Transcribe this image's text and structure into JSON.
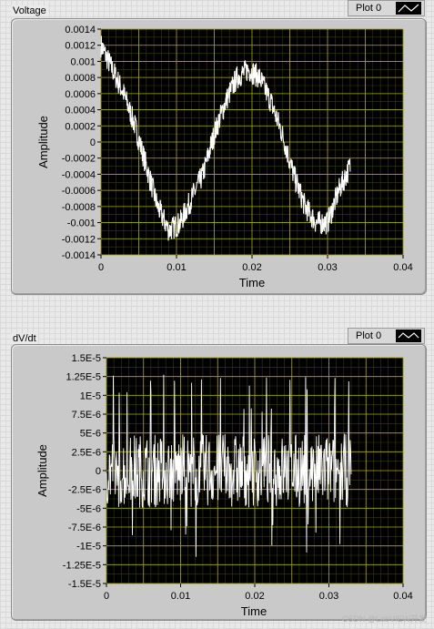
{
  "graph1": {
    "label": "Voltage",
    "legend": "Plot 0",
    "xlabel": "Time",
    "ylabel": "Amplitude",
    "yticks": [
      "0.0014",
      "0.0012",
      "0.001",
      "0.0008",
      "0.0006",
      "0.0004",
      "0.0002",
      "0",
      "-0.0002",
      "-0.0004",
      "-0.0006",
      "-0.0008",
      "-0.001",
      "-0.0012",
      "-0.0014"
    ],
    "xticks": [
      "0",
      "0.01",
      "0.02",
      "0.03",
      "0.04"
    ]
  },
  "graph2": {
    "label": "dV/dt",
    "legend": "Plot 0",
    "xlabel": "Time",
    "ylabel": "Amplitude",
    "yticks": [
      "1.5E-5",
      "1.25E-5",
      "1E-5",
      "7.5E-6",
      "5E-6",
      "2.5E-6",
      "0",
      "-2.5E-6",
      "-5E-6",
      "-7.5E-6",
      "-1E-5",
      "-1.25E-5",
      "-1.5E-5"
    ],
    "xticks": [
      "0",
      "0.01",
      "0.02",
      "0.03",
      "0.04"
    ]
  },
  "watermark": "CSDN @LabVIEW开发",
  "colors": {
    "plot_bg": "#000000",
    "grid_major": "#a8a800",
    "grid_minor": "#3c3c00",
    "trace": "#ffffff"
  },
  "chart_data": [
    {
      "type": "line",
      "title": "Voltage",
      "xlabel": "Time",
      "ylabel": "Amplitude",
      "xlim": [
        0,
        0.04
      ],
      "ylim": [
        -0.0014,
        0.0014
      ],
      "grid": true,
      "legend": "top-right",
      "series": [
        {
          "name": "Plot 0",
          "x": [
            0,
            0.0015,
            0.003,
            0.0045,
            0.006,
            0.0075,
            0.009,
            0.0105,
            0.012,
            0.0135,
            0.015,
            0.0165,
            0.018,
            0.0195,
            0.021,
            0.0225,
            0.024,
            0.0255,
            0.027,
            0.0285,
            0.03,
            0.0315,
            0.033
          ],
          "y": [
            0.0012,
            0.0009,
            0.0006,
            0.0002,
            -0.0003,
            -0.0008,
            -0.0011,
            -0.001,
            -0.0007,
            -0.0004,
            0.0001,
            0.0005,
            0.0008,
            0.0009,
            0.0008,
            0.0005,
            0.0001,
            -0.0004,
            -0.0008,
            -0.001,
            -0.001,
            -0.0006,
            -0.0003
          ],
          "noise": 0.00015
        }
      ]
    },
    {
      "type": "line",
      "title": "dV/dt",
      "xlabel": "Time",
      "ylabel": "Amplitude",
      "xlim": [
        0,
        0.04
      ],
      "ylim": [
        -1.5e-05,
        1.5e-05
      ],
      "grid": true,
      "legend": "top-right",
      "series": [
        {
          "name": "Plot 0",
          "x_range": [
            0,
            0.033
          ],
          "envelope": 1.3e-05,
          "description_values": "high-frequency noise centered near 0, spikes up to about 1.3E-5 and down to about -1.2E-5"
        }
      ]
    }
  ]
}
